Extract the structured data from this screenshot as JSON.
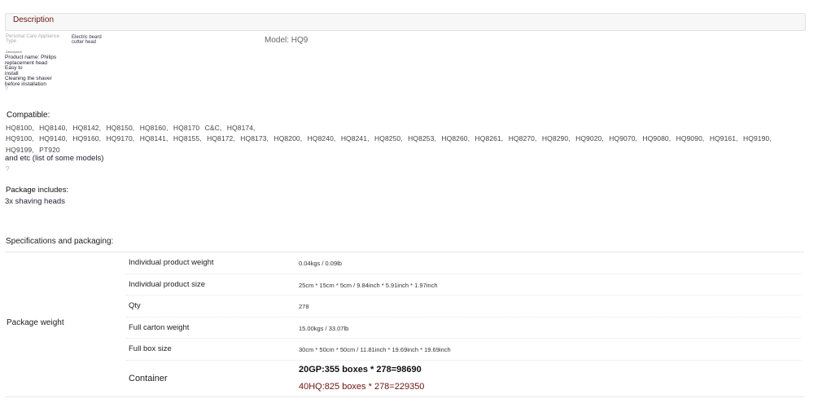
{
  "tab": {
    "label": "Description"
  },
  "info": {
    "label_line1": "Personal Care Appliance",
    "label_line2": "Type",
    "value_line1": "Electric beard",
    "value_line2": "cutter head",
    "model": "Model: HQ9"
  },
  "description": {
    "heading": "Description",
    "lines": [
      "Product name: Philips",
      "replacement head",
      "Easy to",
      "install",
      "Cleaning the shaver",
      "before installation"
    ],
    "mark": "?"
  },
  "compatible": {
    "title": "Compatible:",
    "line1": "HQ8100,  HQ8140,  HQ8142,  HQ8150,  HQ8160,  HQ8170 C&C,  HQ8174,",
    "line2": "HQ9100,  HQ9140,  HQ9160,  HQ9170,  HQ8141,  HQ8155,  HQ8172,  HQ8173,  HQ8200,  HQ8240,  HQ8241,  HQ8250,  HQ8253,  HQ8260,  HQ8261,  HQ8270,  HQ8290,  HQ9020,  HQ9070,  HQ9080,  HQ9090,  HQ9161,  HQ9190,",
    "line3": "HQ9199,  PT920",
    "note": "and etc (list of some models)",
    "mark": "?"
  },
  "package": {
    "title": "Package includes:",
    "item": "3x shaving heads"
  },
  "specs": {
    "title": "Specifications and packaging:",
    "group_label": "Package weight",
    "rows": [
      {
        "key": "Individual product weight",
        "value": "0.04kgs / 0.09lb"
      },
      {
        "key": "Individual product size",
        "value": "25cm * 15cm * 5cm / 9.84inch * 5.91inch * 1.97inch"
      },
      {
        "key": "Qty",
        "value": "278"
      },
      {
        "key": "Full carton weight",
        "value": "15.00kgs / 33.07lb"
      },
      {
        "key": "Full box size",
        "value": "30cm * 50cm * 50cm / 11.81inch * 19.69inch * 19.69inch"
      }
    ],
    "container": {
      "key": "Container",
      "line1": "20GP:355 boxes * 278=98690",
      "line2": "40HQ:825 boxes * 278=229350"
    }
  }
}
